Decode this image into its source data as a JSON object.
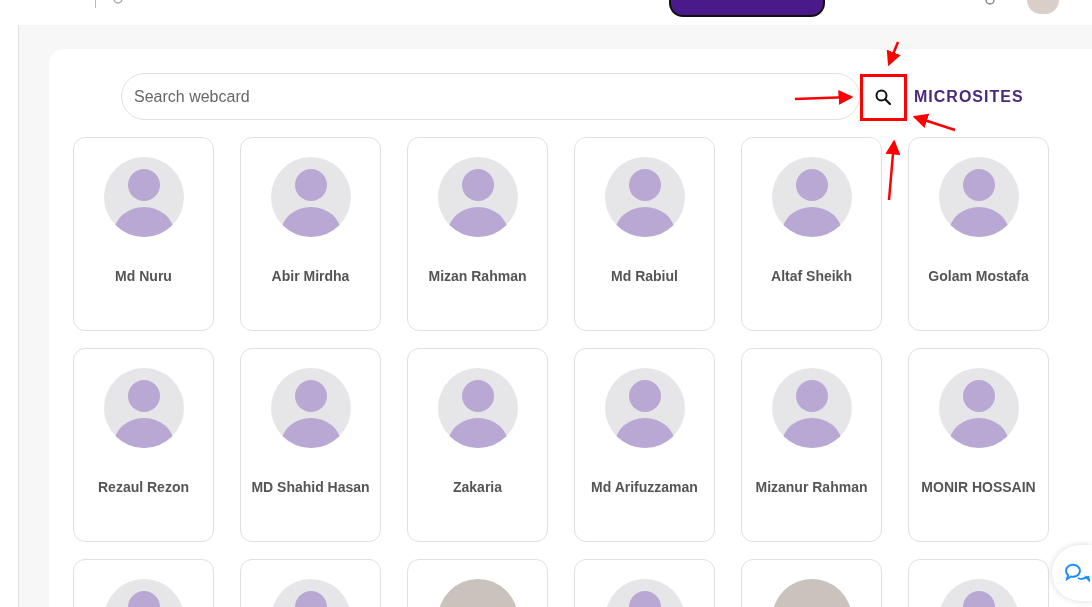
{
  "search": {
    "placeholder": "Search webcard"
  },
  "section_label": "MICROSITES",
  "cards": [
    {
      "kind": "avatar",
      "name": "Md Nuru"
    },
    {
      "kind": "avatar",
      "name": "Abir Mirdha"
    },
    {
      "kind": "avatar",
      "name": "Mizan Rahman"
    },
    {
      "kind": "avatar",
      "name": "Md Rabiul"
    },
    {
      "kind": "avatar",
      "name": "Altaf Sheikh"
    },
    {
      "kind": "avatar",
      "name": "Golam Mostafa"
    },
    {
      "kind": "avatar",
      "name": "Rezaul Rezon"
    },
    {
      "kind": "avatar",
      "name": "MD Shahid Hasan"
    },
    {
      "kind": "avatar",
      "name": "Zakaria"
    },
    {
      "kind": "avatar",
      "name": "Md Arifuzzaman"
    },
    {
      "kind": "avatar",
      "name": "Mizanur Rahman"
    },
    {
      "kind": "avatar",
      "name": "MONIR HOSSAIN"
    },
    {
      "kind": "avatar"
    },
    {
      "kind": "avatar"
    },
    {
      "kind": "photo"
    },
    {
      "kind": "avatar"
    },
    {
      "kind": "photo"
    },
    {
      "kind": "avatar"
    }
  ]
}
